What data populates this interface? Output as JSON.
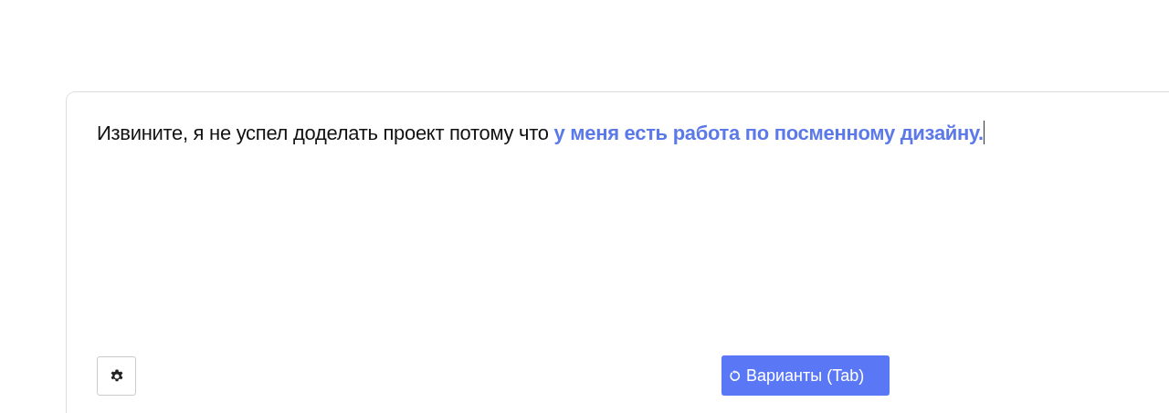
{
  "editor": {
    "text": "Извините, я не успел доделать проект потому что ",
    "suggestion": "у меня есть работа по посменному дизайну."
  },
  "toolbar": {
    "variants_button": "Варианты (Tab)"
  }
}
